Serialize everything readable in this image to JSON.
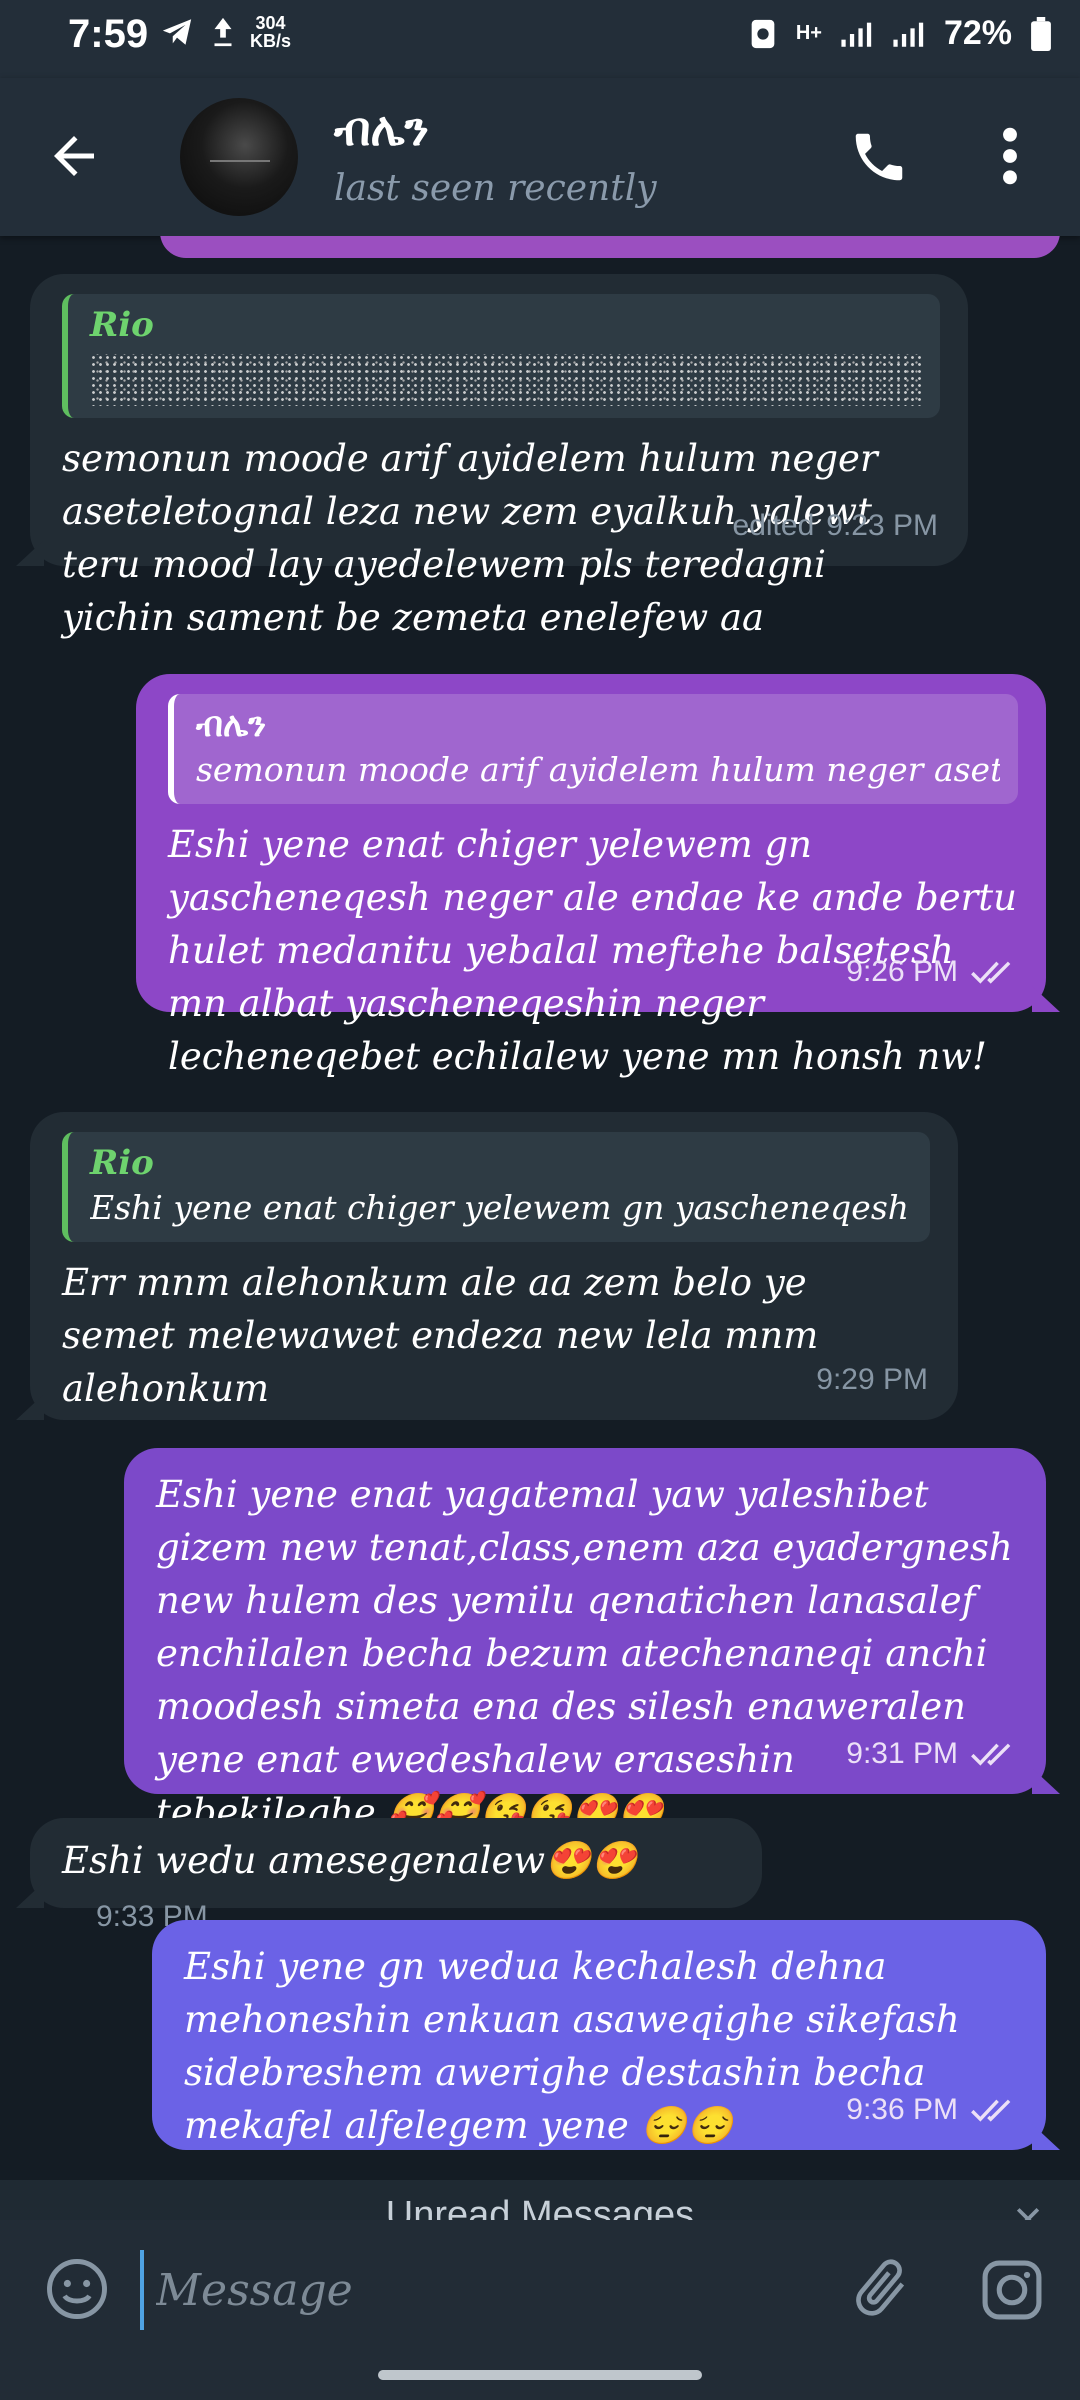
{
  "status_bar": {
    "time": "7:59",
    "speed_value": "304",
    "speed_unit": "KB/s",
    "network": "H+",
    "battery": "72%"
  },
  "header": {
    "contact_name": "ብሌን",
    "last_seen": "last seen recently",
    "icons": [
      "back-arrow-icon",
      "call-icon",
      "more-vertical-icon"
    ]
  },
  "messages": [
    {
      "direction": "in",
      "reply": {
        "name": "Rio",
        "text": ""
      },
      "text": "semonun moode arif ayidelem hulum neger aseteletognal leza new zem eyalkuh yalewt teru mood lay ayedelewem pls teredagni yichin sament be zemeta enelefew aa",
      "edited": "edited",
      "time": "9:23 PM"
    },
    {
      "direction": "out",
      "reply": {
        "name": "ብሌን",
        "text": "semonun moode arif ayidelem hulum neger aseteleto..."
      },
      "text": "Eshi yene enat chiger yelewem gn yascheneqesh neger ale endae ke ande bertu hulet medanitu yebalal meftehe balsetesh mn albat yascheneqeshin neger lecheneqebet echilalew yene mn honsh nw!",
      "time": "9:26 PM"
    },
    {
      "direction": "in",
      "reply": {
        "name": "Rio",
        "text": "Eshi yene enat chiger yelewem gn yascheneqesh neger..."
      },
      "text": "Err mnm alehonkum ale aa zem belo ye semet melewawet endeza new lela mnm alehonkum",
      "time": "9:29 PM"
    },
    {
      "direction": "out",
      "text": "Eshi yene enat yagatemal yaw yaleshibet gizem new tenat,class,enem aza eyadergnesh new hulem des yemilu qenatichen lanasalef enchilalen becha bezum atechenaneqi anchi moodesh simeta ena des silesh enaweralen yene enat ewedeshalew eraseshin tebekileghe 🥰🥰😘😘😍😍",
      "time": "9:31 PM"
    },
    {
      "direction": "in",
      "text": "Eshi wedu amesegenalew😍😍",
      "time": "9:33 PM"
    },
    {
      "direction": "out",
      "text": "Eshi yene gn wedua kechalesh dehna mehoneshin enkuan asaweqighe sikefash sidebreshem awerighe destashin becha mekafel alfelegem yene 😔😔",
      "time": "9:36 PM"
    }
  ],
  "unread_banner": {
    "label": "Unread Messages"
  },
  "composer": {
    "placeholder": "Message"
  },
  "colors": {
    "chat_bg": "#141c24",
    "header_bg": "#232e39",
    "incoming_bubble": "#222c34",
    "outgoing_bubble": "#8a44c6",
    "reply_accent_green": "#5fbe5f",
    "cursor_blue": "#4fa3e3"
  }
}
